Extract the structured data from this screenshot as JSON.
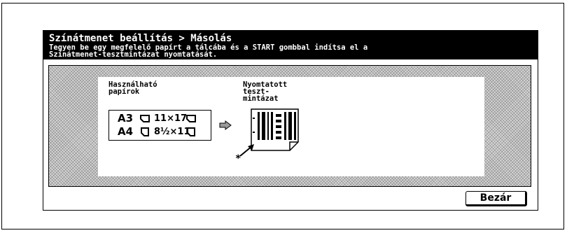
{
  "header": {
    "title": "Színátmenet beállítás > Másolás",
    "message": "Tegyen be egy megfelelő papírt a tálcába és a START gombbal indítsa el a\nSzínátmenet-tesztmintázat nyomtatását."
  },
  "content": {
    "usable_papers_label": "Használható\npapírok",
    "printed_pattern_label": "Nyomtatott\nteszt-\nmintázat",
    "papers": [
      {
        "size": "A3",
        "orientation": "landscape"
      },
      {
        "size": "11×17",
        "orientation": "landscape"
      },
      {
        "size": "A4",
        "orientation": "portrait"
      },
      {
        "size": "8½×11",
        "orientation": "portrait"
      }
    ],
    "arrow_icon": "right-arrow-icon",
    "marker": "*"
  },
  "footer": {
    "close_label": "Bezár"
  }
}
